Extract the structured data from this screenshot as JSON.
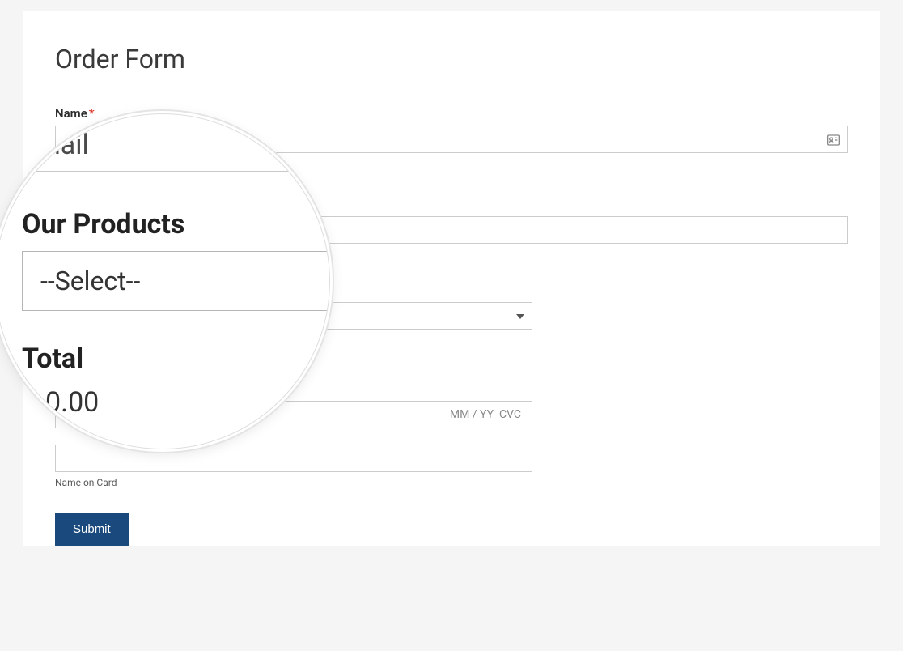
{
  "page": {
    "title": "Order Form"
  },
  "form": {
    "name_label": "Name",
    "required_mark": "*",
    "products_placeholder": "--Select--",
    "cc_expiry_placeholder": "MM / YY",
    "cc_cvc_placeholder": "CVC",
    "name_on_card_label": "Name on Card",
    "submit_label": "Submit"
  },
  "lens": {
    "partial_email": "nail",
    "products_heading": "Our Products",
    "select_placeholder": "--Select--",
    "total_heading": "Total",
    "total_value": "0.00"
  }
}
